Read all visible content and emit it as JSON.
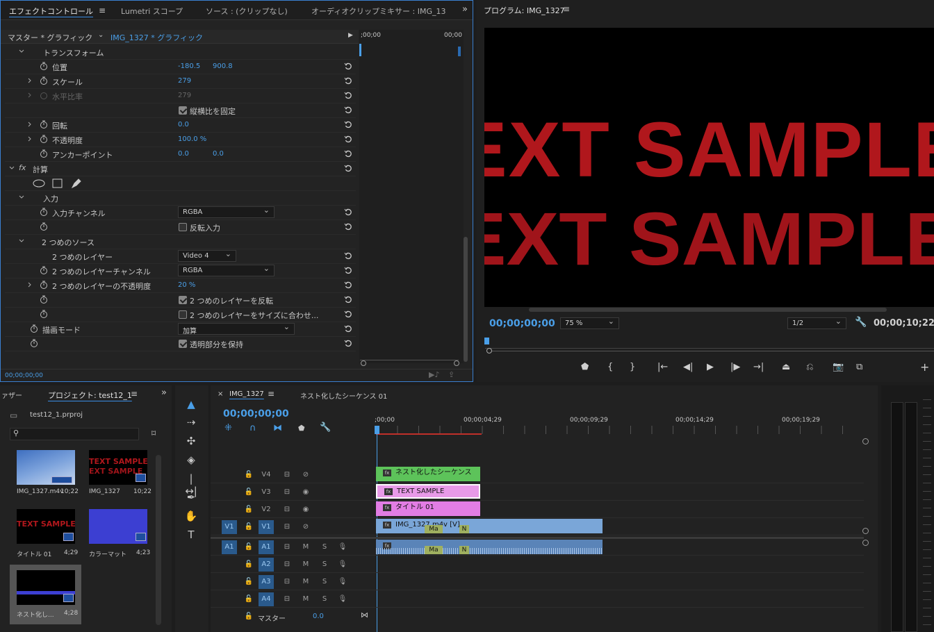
{
  "effect_controls": {
    "tabs": [
      "エフェクトコントロール",
      "Lumetri スコープ",
      "ソース : (クリップなし)",
      "オーディオクリップミキサー : IMG_1327"
    ],
    "master_label": "マスター * グラフィック",
    "clip_label": "IMG_1327 * グラフィック",
    "ruler_start": ";00;00",
    "ruler_end": "00;00",
    "transform": "トランスフォーム",
    "position_label": "位置",
    "position_x": "-180.5",
    "position_y": "900.8",
    "scale_label": "スケール",
    "scale_val": "279",
    "hscale_label": "水平比率",
    "hscale_val": "279",
    "uniform_label": "縦横比を固定",
    "rotation_label": "回転",
    "rotation_val": "0.0",
    "opacity_label": "不透明度",
    "opacity_val": "100.0 %",
    "anchor_label": "アンカーポイント",
    "anchor_x": "0.0",
    "anchor_y": "0.0",
    "calc_label": "計算",
    "input_label": "入力",
    "input_channel_label": "入力チャンネル",
    "input_channel_val": "RGBA",
    "invert_input_label": "反転入力",
    "second_source_label": "2 つめのソース",
    "second_layer_label": "2 つめのレイヤー",
    "second_layer_val": "Video 4",
    "second_channel_label": "2 つめのレイヤーチャンネル",
    "second_channel_val": "RGBA",
    "second_opacity_label": "2 つめのレイヤーの不透明度",
    "second_opacity_val": "20 %",
    "invert_second_label": "2 つめのレイヤーを反転",
    "fit_second_label": "2 つめのレイヤーをサイズに合わせ...",
    "blend_mode_label": "描画モード",
    "blend_mode_val": "加算",
    "preserve_label": "透明部分を保持",
    "timecode": "00;00;00;00"
  },
  "program": {
    "title": "プログラム: IMG_1327",
    "line1": "EXT SAMPLE",
    "line2": "EXT SAMPLE",
    "timecode": "00;00;00;00",
    "zoom": "75 %",
    "resolution": "1/2",
    "duration": "00;00;10;22"
  },
  "project": {
    "tab_prev": "ァザー",
    "tab": "プロジェクト: test12_1",
    "file": "test12_1.prproj",
    "items": [
      {
        "name": "IMG_1327.m4v",
        "dur": "10;22"
      },
      {
        "name": "IMG_1327",
        "dur": "10;22",
        "text1": "TEXT SAMPLE",
        "text2": "EXT SAMPLE"
      },
      {
        "name": "タイトル 01",
        "dur": "4;29",
        "text1": "TEXT SAMPLE"
      },
      {
        "name": "カラーマット",
        "dur": "4;23"
      },
      {
        "name": "ネスト化し...",
        "dur": "4;28"
      }
    ]
  },
  "timeline": {
    "tab1": "IMG_1327",
    "tab2": "ネスト化したシーケンス 01",
    "timecode": "00;00;00;00",
    "ruler": [
      ";00;00",
      "00;00;04;29",
      "00;00;09;29",
      "00;00;14;29",
      "00;00;19;29"
    ],
    "v_tracks": [
      "V4",
      "V3",
      "V2",
      "V1"
    ],
    "a_tracks": [
      "A1",
      "A2",
      "A3",
      "A4"
    ],
    "src_v": "V1",
    "src_a": "A1",
    "m": "M",
    "s": "S",
    "master": "マスター",
    "master_val": "0.0",
    "clips": {
      "nest": "ネスト化したシーケンス",
      "text": "TEXT SAMPLE",
      "title": "タイトル 01",
      "video": "IMG_1327.m4v [V]",
      "marker": "Ma",
      "marker2": "N"
    },
    "fx": "fx"
  },
  "colors": {
    "accent": "#4a9fe8",
    "nest_clip": "#5dc35a",
    "text_clip": "#e89ae8",
    "title_clip": "#e27de4",
    "video_clip": "#7aa6d8",
    "preview_text": "#b0171c"
  }
}
